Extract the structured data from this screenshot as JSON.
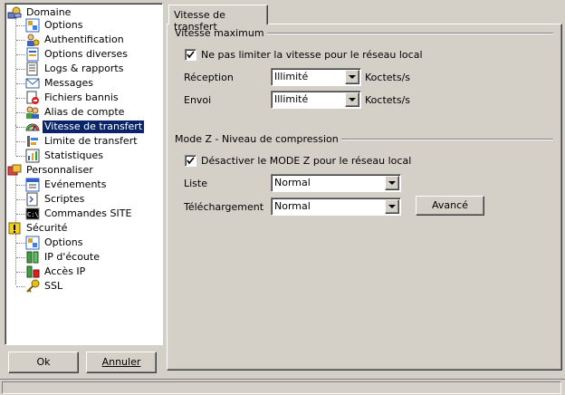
{
  "tree": {
    "groups": [
      {
        "label": "Domaine",
        "icon": "domain-icon",
        "items": [
          {
            "label": "Options",
            "icon": "options-icon"
          },
          {
            "label": "Authentification",
            "icon": "auth-icon"
          },
          {
            "label": "Options diverses",
            "icon": "misc-options-icon"
          },
          {
            "label": "Logs & rapports",
            "icon": "logs-icon"
          },
          {
            "label": "Messages",
            "icon": "messages-icon"
          },
          {
            "label": "Fichiers bannis",
            "icon": "banned-files-icon"
          },
          {
            "label": "Alias de compte",
            "icon": "alias-icon"
          },
          {
            "label": "Vitesse de transfert",
            "icon": "speed-gauge-icon",
            "selected": true
          },
          {
            "label": "Limite de transfert",
            "icon": "transfer-limit-icon"
          },
          {
            "label": "Statistiques",
            "icon": "statistics-icon"
          }
        ]
      },
      {
        "label": "Personnaliser",
        "icon": "customize-icon",
        "items": [
          {
            "label": "Evénements",
            "icon": "events-icon"
          },
          {
            "label": "Scriptes",
            "icon": "scripts-icon"
          },
          {
            "label": "Commandes SITE",
            "icon": "site-commands-icon"
          }
        ]
      },
      {
        "label": "Sécurité",
        "icon": "security-icon",
        "items": [
          {
            "label": "Options",
            "icon": "security-options-icon"
          },
          {
            "label": "IP d'écoute",
            "icon": "listen-ip-icon"
          },
          {
            "label": "Accès IP",
            "icon": "ip-access-icon"
          },
          {
            "label": "SSL",
            "icon": "ssl-key-icon"
          }
        ]
      }
    ]
  },
  "buttons": {
    "ok": "Ok",
    "cancel": "Annuler",
    "advanced": "Avancé"
  },
  "tab": {
    "label": "Vitesse de transfert"
  },
  "speed": {
    "group_title": "Vitesse maximum",
    "no_limit_checkbox": {
      "label": "Ne pas limiter la vitesse pour le réseau local",
      "checked": true
    },
    "reception": {
      "label": "Réception",
      "value": "Illimité",
      "unit": "Koctets/s"
    },
    "send": {
      "label": "Envoi",
      "value": "Illimité",
      "unit": "Koctets/s"
    }
  },
  "compression": {
    "group_title": "Mode Z - Niveau de compression",
    "disable_checkbox": {
      "label": "Désactiver le MODE Z pour le réseau local",
      "checked": true
    },
    "list": {
      "label": "Liste",
      "value": "Normal"
    },
    "download": {
      "label": "Téléchargement",
      "value": "Normal"
    }
  }
}
